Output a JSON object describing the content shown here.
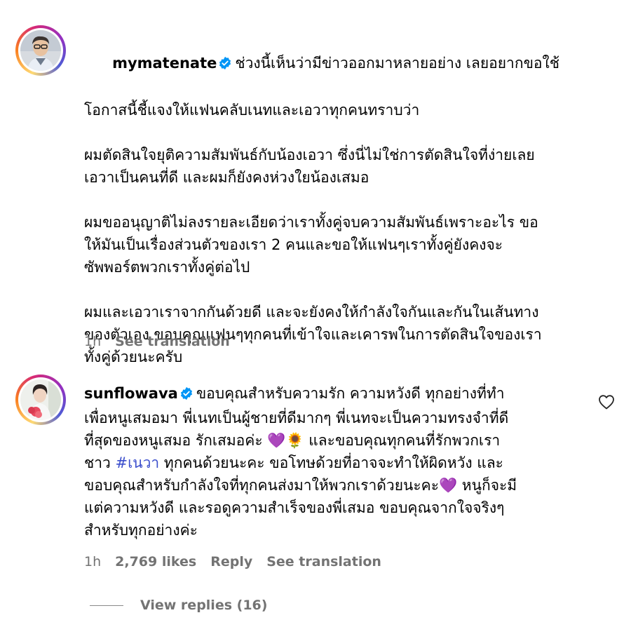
{
  "comments": [
    {
      "username": "mymatenate",
      "verified": true,
      "lines": [
        "ช่วงนี้เห็นว่ามีข่าวออกมาหลายอย่าง เลยอยากขอใช้",
        "โอกาสนี้ชี้แจงให้แฟนคลับเนทและเอวาทุกคนทราบว่า",
        "",
        "ผมตัดสินใจยุติความสัมพันธ์กับน้องเอวา ซึ่งนี่ไม่ใช่การตัดสินใจที่ง่ายเลย",
        "เอวาเป็นคนที่ดี และผมก็ยังคงห่วงใยน้องเสมอ",
        "",
        "ผมขออนุญาติไม่ลงรายละเอียดว่าเราทั้งคู่จบความสัมพันธ์เพราะอะไร ขอ",
        "ให้มันเป็นเรื่องส่วนตัวของเรา 2 คนและขอให้แฟนๆเราทั้งคู่ยังคงจะ",
        "ซัพพอร์ตพวกเราทั้งคู่ต่อไป",
        "",
        "ผมและเอวาเราจากกันด้วยดี และจะยังคงให้กำลังใจกันและกันในเส้นทาง",
        "ของตัวเอง ขอบคุณแฟนๆทุกคนที่เข้าใจและเคารพในการตัดสินใจของเรา",
        "ทั้งคู่ด้วยนะครับ"
      ],
      "time": "1h",
      "see_translation": "See translation"
    },
    {
      "username": "sunflowava",
      "verified": true,
      "line1": "ขอบคุณสำหรับความรัก ความหวังดี ทุกอย่างที่ทำ",
      "line2": "เพื่อหนูเสมอมา พี่เนทเป็นผู้ชายที่ดีมากๆ พี่เนทจะเป็นความทรงจำที่ดี",
      "line3": "ที่สุดของหนูเสมอ รักเสมอค่ะ 💜🌻 และขอบคุณทุกคนที่รักพวกเรา",
      "line4_pre": "ชาว ",
      "hashtag": "#เนวา",
      "line4_post": " ทุกคนด้วยนะคะ ขอโทษด้วยที่อาจจะทำให้ผิดหวัง และ",
      "line5": "ขอบคุณสำหรับกำลังใจที่ทุกคนส่งมาให้พวกเราด้วยนะคะ💜 หนูก็จะมี",
      "line6": "แต่ความหวังดี และรอดูความสำเร็จของพี่เสมอ ขอบคุณจากใจจริงๆ",
      "line7": "สำหรับทุกอย่างค่ะ",
      "time": "1h",
      "likes": "2,769 likes",
      "reply": "Reply",
      "see_translation": "See translation",
      "view_replies": "View replies (16)"
    }
  ],
  "colors": {
    "meta": "#737373",
    "hashtag": "#3b4ecc",
    "verified": "#0095f6"
  }
}
